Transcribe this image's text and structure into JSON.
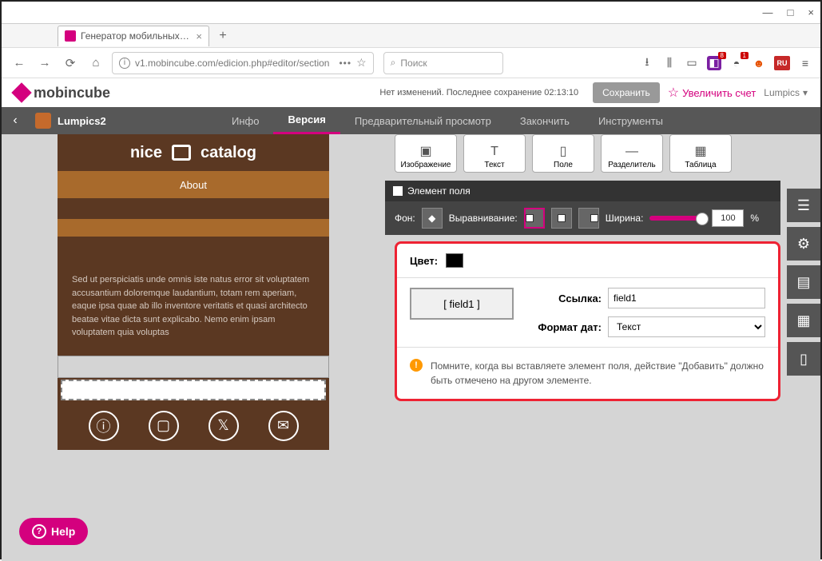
{
  "window": {
    "min": "—",
    "max": "□",
    "close": "×"
  },
  "tab": {
    "title": "Генератор мобильных прило",
    "close": "×",
    "new": "+"
  },
  "nav": {
    "back": "←",
    "fwd": "→",
    "reload": "⟳",
    "home": "⌂",
    "url": "v1.mobincube.com/edicion.php#editor/section",
    "dots": "•••",
    "star": "☆",
    "search_icon": "⌕",
    "search_ph": "Поиск",
    "dl": "⭳",
    "lib": "⫼",
    "read": "▭",
    "menu": "≡"
  },
  "ext": {
    "b1": "8",
    "b2": "1",
    "ru": "RU"
  },
  "header": {
    "logo": "mobincube",
    "status": "Нет изменений. Последнее сохранение 02:13:10",
    "save": "Сохранить",
    "upgrade": "Увеличить счет",
    "user": "Lumpics",
    "chev": "▾"
  },
  "greybar": {
    "back": "‹",
    "project": "Lumpics2",
    "tabs": [
      "Инфо",
      "Версия",
      "Предварительный просмотр",
      "Закончить",
      "Инструменты"
    ],
    "active": 1
  },
  "phone": {
    "title_left": "nice",
    "title_right": "catalog",
    "about": "About",
    "lorem": "Sed ut perspiciatis unde omnis iste natus error sit voluptatem accusantium doloremque laudantium, totam rem aperiam, eaque ipsa quae ab illo inventore veritatis et quasi architecto beatae vitae dicta sunt explicabo. Nemo enim ipsam voluptatem quia voluptas",
    "ficons": [
      "ⓘ",
      "▢",
      "𝕏",
      "✉"
    ]
  },
  "tools": [
    {
      "icon": "▣",
      "label": "Изображение"
    },
    {
      "icon": "T",
      "label": "Текст"
    },
    {
      "icon": "▯",
      "label": "Поле"
    },
    {
      "icon": "—",
      "label": "Разделитель"
    },
    {
      "icon": "▦",
      "label": "Таблица"
    }
  ],
  "section": {
    "title": "Элемент поля"
  },
  "props": {
    "bg": "Фон:",
    "align": "Выравнивание:",
    "width": "Ширина:",
    "width_val": "100",
    "pct": "%"
  },
  "panel": {
    "color_lbl": "Цвет:",
    "field_btn": "[ field1 ]",
    "link_lbl": "Ссылка:",
    "link_val": "field1",
    "date_lbl": "Формат дат:",
    "date_val": "Текст",
    "warn": "Помните, когда вы вставляете элемент поля, действие \"Добавить\" должно быть отмечено на другом элементе."
  },
  "help": "Help"
}
